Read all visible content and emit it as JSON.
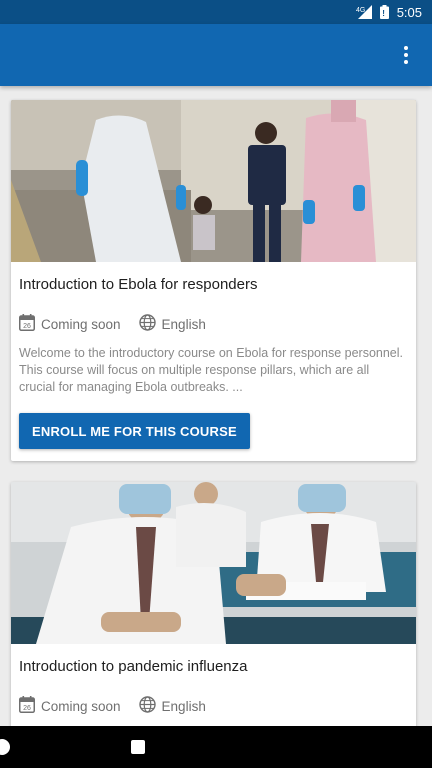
{
  "status_bar": {
    "signal_label": "4G",
    "time": "5:05",
    "icons": [
      "signal-icon",
      "battery-icon"
    ]
  },
  "app_bar": {
    "overflow_icon": "more-vert-icon"
  },
  "courses": [
    {
      "title": "Introduction to Ebola for responders",
      "status": "Coming soon",
      "language": "English",
      "description": "Welcome to the introductory course on Ebola for response personnel. This course will focus on multiple response pillars, which are all crucial for managing Ebola outbreaks. ...",
      "enroll_label": "ENROLL ME FOR THIS COURSE",
      "calendar_day": "26",
      "image": "responders-in-protective-gear-with-children"
    },
    {
      "title": "Introduction to pandemic influenza",
      "status": "Coming soon",
      "language": "English",
      "calendar_day": "26",
      "image": "students-wearing-masks-in-classroom"
    }
  ],
  "colors": {
    "status_bar": "#0b4f86",
    "app_bar": "#1167b1",
    "button": "#1167b1",
    "background": "#ececec"
  },
  "nav_bar": {
    "icons": [
      "back-icon",
      "recents-icon"
    ]
  }
}
